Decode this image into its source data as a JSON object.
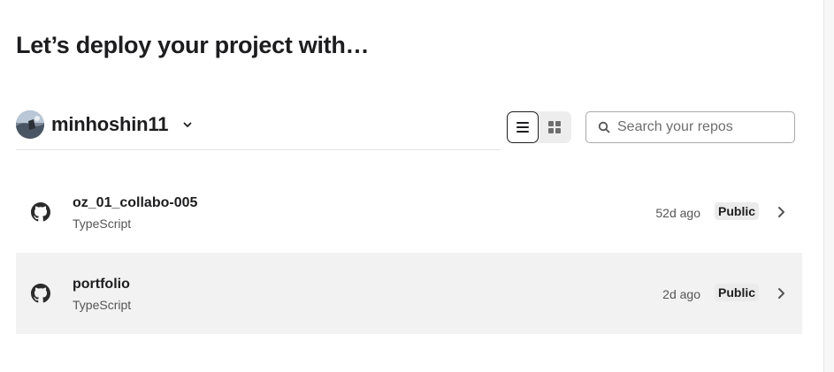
{
  "page": {
    "title": "Let’s deploy your project with…"
  },
  "account": {
    "name": "minhoshin11",
    "avatar_icon": "avatar-photo",
    "dropdown_icon": "chevron-down-icon"
  },
  "view_toggle": {
    "options": [
      {
        "name": "list-view",
        "icon": "list-icon",
        "active": true
      },
      {
        "name": "grid-view",
        "icon": "grid-icon",
        "active": false
      }
    ]
  },
  "search": {
    "placeholder": "Search your repos",
    "value": "",
    "icon": "search-icon"
  },
  "repos": [
    {
      "name": "oz_01_collabo-005",
      "language": "TypeScript",
      "updated": "52d ago",
      "visibility": "Public",
      "icon": "github-icon",
      "highlighted": false
    },
    {
      "name": "portfolio",
      "language": "TypeScript",
      "updated": "2d ago",
      "visibility": "Public",
      "icon": "github-icon",
      "highlighted": true
    }
  ],
  "colors": {
    "text": "#1d1d1f",
    "muted": "#555555",
    "row_highlight": "#f2f2f2",
    "badge_bg": "#ebebeb"
  }
}
